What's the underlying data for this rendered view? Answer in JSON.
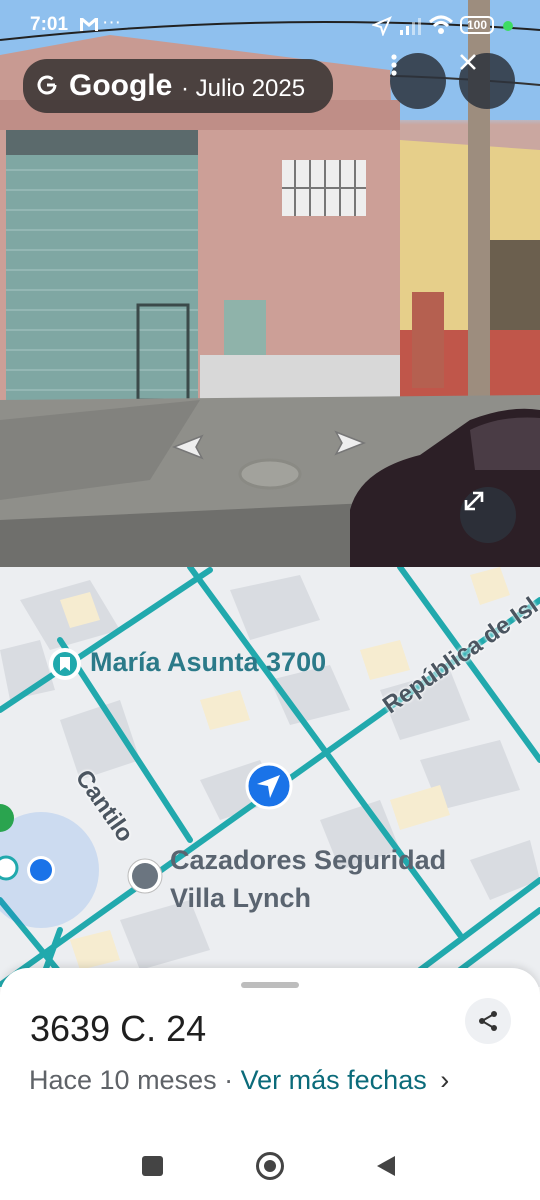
{
  "status_bar": {
    "time": "7:01",
    "battery": "100"
  },
  "street_view": {
    "brand": "Google",
    "date_label": "· Julio 2025",
    "menu_icon": "more-vert-icon",
    "close_icon": "close-icon",
    "expand_icon": "expand-icon",
    "nav_left_icon": "chevron-left-icon",
    "nav_right_icon": "chevron-right-icon"
  },
  "map": {
    "place_label": "María Asunta 3700",
    "place2_label_line1": "Cazadores Seguridad",
    "place2_label_line2": "Villa Lynch",
    "street_1": "Cantilo",
    "street_2": "República de Isl",
    "colors": {
      "road": "#21a9ad",
      "block": "#d9dce1",
      "accent": "#1a73e8"
    }
  },
  "sheet": {
    "address": "3639 C. 24",
    "subtitle_prefix": "Hace 10 meses",
    "subtitle_sep": "·",
    "more_dates_link": "Ver más fechas",
    "chevron": "›"
  },
  "system_nav": {
    "recent_icon": "square-icon",
    "home_icon": "circle-icon",
    "back_icon": "triangle-back-icon"
  }
}
